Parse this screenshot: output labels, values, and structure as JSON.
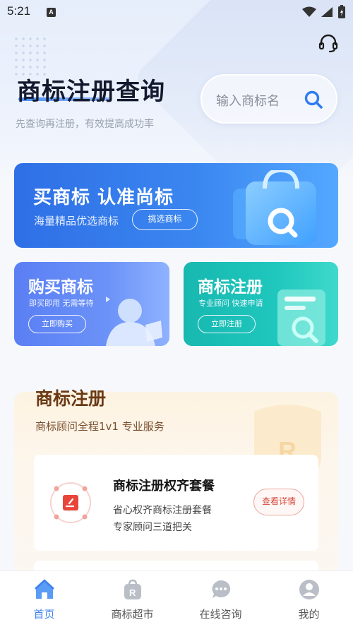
{
  "status_bar": {
    "time": "5:21",
    "notification_letter": "A"
  },
  "header": {
    "title": "商标注册查询",
    "subtitle": "先查询再注册，有效提高成功率",
    "support_icon": "headset-icon"
  },
  "search": {
    "placeholder": "输入商标名",
    "icon": "search-icon"
  },
  "banner": {
    "title": "买商标 认准尚标",
    "subtitle": "海量精品优选商标",
    "button": "挑选商标"
  },
  "cards": {
    "buy": {
      "title": "购买商标",
      "subtitle": "即买即用 无需等待",
      "button": "立即购买"
    },
    "register": {
      "title": "商标注册",
      "subtitle": "专业顾问 快速申请",
      "button": "立即注册"
    }
  },
  "section": {
    "title": "商标注册",
    "subtitle": "商标顾问全程1v1 专业服务",
    "package": {
      "title": "商标注册权齐套餐",
      "line1": "省心权齐商标注册套餐",
      "line2": "专家顾问三道把关",
      "button": "查看详情"
    }
  },
  "bottom_nav": [
    {
      "label": "首页",
      "icon": "home-icon",
      "active": true
    },
    {
      "label": "商标超市",
      "icon": "bag-icon",
      "active": false
    },
    {
      "label": "在线咨询",
      "icon": "chat-icon",
      "active": false
    },
    {
      "label": "我的",
      "icon": "user-icon",
      "active": false
    }
  ],
  "colors": {
    "accent": "#3d82ee",
    "banner_blue": "#2f6fe6",
    "card_teal": "#17b8b0",
    "card_violet": "#5b7ff4",
    "section_brown": "#6a3a14",
    "detail_red": "#d3483c"
  }
}
